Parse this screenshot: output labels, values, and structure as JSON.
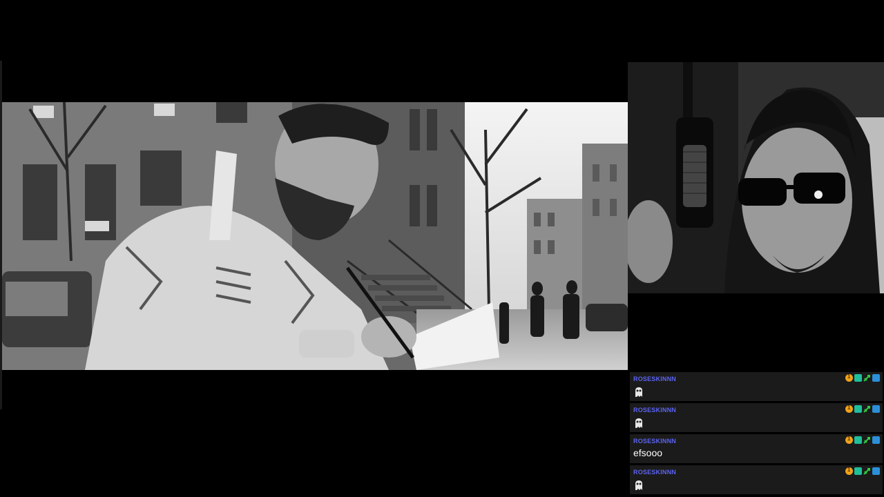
{
  "stream": {
    "video": {
      "description_icon": "music-video-frame"
    },
    "webcam": {
      "description_icon": "streamer-webcam"
    }
  },
  "chat": {
    "messages": [
      {
        "username": "ROSESKINNN",
        "text": "",
        "emote": "ghost-emote"
      },
      {
        "username": "ROSESKINNN",
        "text": "",
        "emote": "ghost-emote"
      },
      {
        "username": "ROSESKINNN",
        "text": "efsooo",
        "emote": ""
      },
      {
        "username": "ROSESKINNN",
        "text": "",
        "emote": "ghost-emote"
      }
    ],
    "badge_colors": {
      "coin": "#f1a21a",
      "sub": "#1fbf9a",
      "mod": "#2ecc40",
      "arrow": "#2c8fd8"
    },
    "username_color": "#5b63f2"
  }
}
